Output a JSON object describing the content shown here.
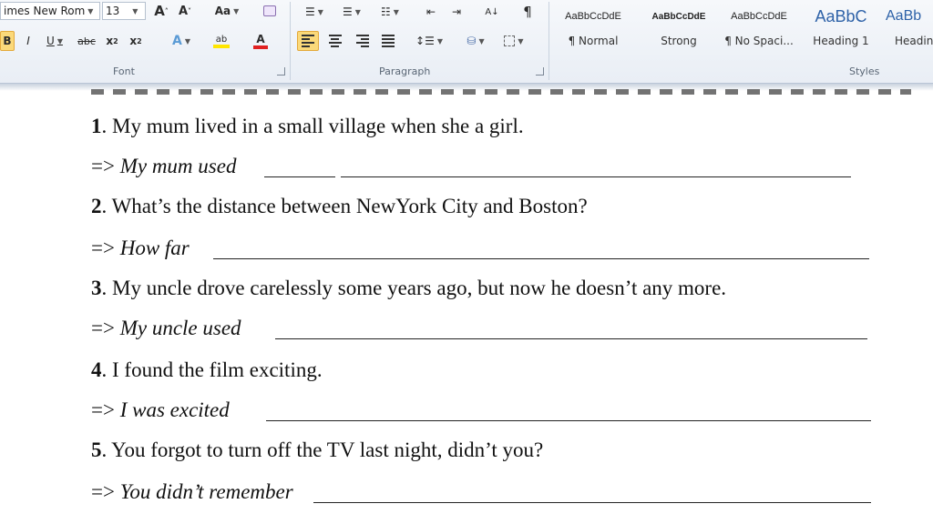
{
  "ribbon": {
    "font": {
      "font_name": "imes New Rom",
      "font_size": "13",
      "grow_glyph": "A",
      "shrink_glyph": "A",
      "change_case": "Aa",
      "bold": "B",
      "italic": "I",
      "underline": "U",
      "strike": "abc",
      "subscript": "x",
      "superscript": "x",
      "highlight": "ab",
      "font_color": "A",
      "label": "Font"
    },
    "paragraph": {
      "label": "Paragraph",
      "pilcrow": "¶",
      "sort": "A↓"
    },
    "styles": {
      "label": "Styles",
      "items": [
        {
          "sample": "AaBbCcDdE",
          "name": "¶ Normal"
        },
        {
          "sample": "AaBbCcDdE",
          "name": "Strong"
        },
        {
          "sample": "AaBbCcDdE",
          "name": "¶ No Spaci..."
        },
        {
          "sample": "AaBbC",
          "name": "Heading 1"
        },
        {
          "sample": "AaBb",
          "name": "Headin"
        }
      ]
    }
  },
  "document": {
    "exercises": [
      {
        "number": "1",
        "question": ". My mum lived in a small village when she a girl.",
        "prompt": "My mum used"
      },
      {
        "number": "2",
        "question": ". What’s the distance between NewYork City and Boston?",
        "prompt": "How far"
      },
      {
        "number": "3",
        "question": ". My uncle drove carelessly some years ago, but now he doesn’t any more.",
        "prompt": "My uncle used"
      },
      {
        "number": "4",
        "question": ". I found the film exciting.",
        "prompt": "I was excited"
      },
      {
        "number": "5",
        "question": ". You forgot to turn off the TV last night, didn’t you?",
        "prompt": "You didn’t remember"
      }
    ],
    "arrow": "=>"
  },
  "colors": {
    "active_button": "#fbd97a",
    "heading_style": "#2e62a8",
    "font_color_bar": "#e02020",
    "highlight_bar": "#ffe600"
  }
}
